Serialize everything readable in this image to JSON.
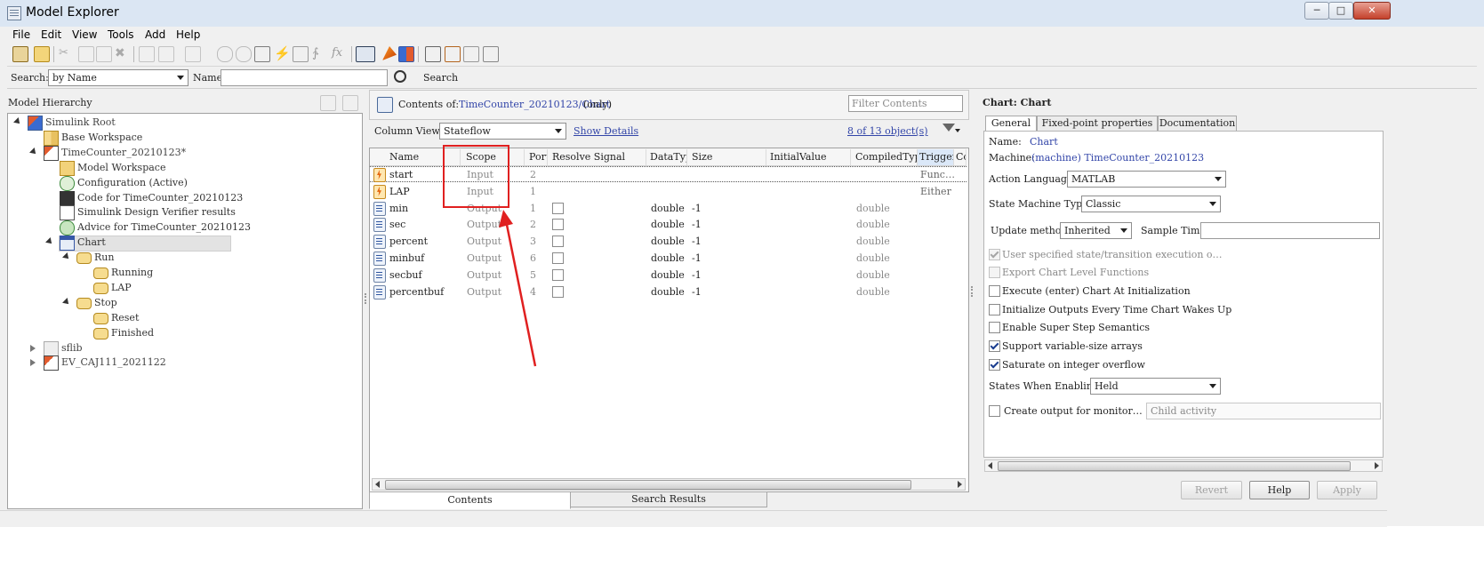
{
  "window": {
    "title": "Model Explorer",
    "buttons": {
      "minimize": "─",
      "maximize": "□",
      "close": "✕"
    }
  },
  "menu": [
    "File",
    "Edit",
    "View",
    "Tools",
    "Add",
    "Help"
  ],
  "search_bar": {
    "search_label": "Search:",
    "search_by": "by Name",
    "name_label": "Name:",
    "name_value": "",
    "search_button": "Search"
  },
  "hierarchy": {
    "title": "Model Hierarchy",
    "items": [
      {
        "label": "Simulink Root",
        "icon": "simulink-root-icon"
      },
      {
        "label": "Base Workspace",
        "icon": "workspace-icon"
      },
      {
        "label": "TimeCounter_20210123*",
        "icon": "model-icon"
      },
      {
        "label": "Model Workspace",
        "icon": "model-workspace-icon"
      },
      {
        "label": "Configuration (Active)",
        "icon": "config-icon"
      },
      {
        "label": "Code for TimeCounter_20210123",
        "icon": "code-icon"
      },
      {
        "label": "Simulink Design Verifier results",
        "icon": "sldv-icon"
      },
      {
        "label": "Advice for TimeCounter_20210123",
        "icon": "advice-icon"
      },
      {
        "label": "Chart",
        "icon": "chart-icon"
      },
      {
        "label": "Run",
        "icon": "state-icon"
      },
      {
        "label": "Running",
        "icon": "state-icon"
      },
      {
        "label": "LAP",
        "icon": "state-icon"
      },
      {
        "label": "Stop",
        "icon": "state-icon"
      },
      {
        "label": "Reset",
        "icon": "state-icon"
      },
      {
        "label": "Finished",
        "icon": "state-icon"
      },
      {
        "label": "sflib",
        "icon": "library-icon"
      },
      {
        "label": "EV_CAJ111_2021122",
        "icon": "model-icon"
      }
    ]
  },
  "contents": {
    "label": "Contents of:",
    "path": "TimeCounter_20210123/Chart",
    "scope_note": "(only)",
    "filter_placeholder": "Filter Contents",
    "column_view_label": "Column View:",
    "column_view": "Stateflow",
    "show_details": "Show Details",
    "object_count": "8 of 13 object(s)",
    "columns": [
      "Name",
      "Scope",
      "Port",
      "Resolve Signal",
      "DataType",
      "Size",
      "InitialValue",
      "CompiledType",
      "Trigger",
      "Co"
    ],
    "rows": [
      {
        "icon": "event-icon",
        "name": "start",
        "scope": "Input",
        "port": "2",
        "resolve": false,
        "datatype": "",
        "size": "",
        "compiled": "",
        "trigger": "Func…"
      },
      {
        "icon": "event-icon",
        "name": "LAP",
        "scope": "Input",
        "port": "1",
        "resolve": false,
        "datatype": "",
        "size": "",
        "compiled": "",
        "trigger": "Either"
      },
      {
        "icon": "data-icon",
        "name": "min",
        "scope": "Output",
        "port": "1",
        "resolve": false,
        "datatype": "double",
        "size": "-1",
        "compiled": "double",
        "trigger": ""
      },
      {
        "icon": "data-icon",
        "name": "sec",
        "scope": "Output",
        "port": "2",
        "resolve": false,
        "datatype": "double",
        "size": "-1",
        "compiled": "double",
        "trigger": ""
      },
      {
        "icon": "data-icon",
        "name": "percent",
        "scope": "Output",
        "port": "3",
        "resolve": false,
        "datatype": "double",
        "size": "-1",
        "compiled": "double",
        "trigger": ""
      },
      {
        "icon": "data-icon",
        "name": "minbuf",
        "scope": "Output",
        "port": "6",
        "resolve": false,
        "datatype": "double",
        "size": "-1",
        "compiled": "double",
        "trigger": ""
      },
      {
        "icon": "data-icon",
        "name": "secbuf",
        "scope": "Output",
        "port": "5",
        "resolve": false,
        "datatype": "double",
        "size": "-1",
        "compiled": "double",
        "trigger": ""
      },
      {
        "icon": "data-icon",
        "name": "percentbuf",
        "scope": "Output",
        "port": "4",
        "resolve": false,
        "datatype": "double",
        "size": "-1",
        "compiled": "double",
        "trigger": ""
      }
    ],
    "bottom_tabs": [
      "Contents",
      "Search Results"
    ]
  },
  "properties": {
    "title": "Chart: Chart",
    "tabs": [
      "General",
      "Fixed-point properties",
      "Documentation"
    ],
    "name_label": "Name:",
    "name_value": "Chart",
    "machine_label": "Machine:",
    "machine_value": "(machine) TimeCounter_20210123",
    "action_language_label": "Action Language:",
    "action_language": "MATLAB",
    "state_machine_type_label": "State Machine Type:",
    "state_machine_type": "Classic",
    "update_method_label": "Update method:",
    "update_method": "Inherited",
    "sample_time_label": "Sample Time:",
    "sample_time": "",
    "checkboxes": [
      {
        "label": "User specified state/transition execution o…",
        "checked": true,
        "disabled": true
      },
      {
        "label": "Export Chart Level Functions",
        "checked": false,
        "disabled": true
      },
      {
        "label": "Execute (enter) Chart At Initialization",
        "checked": false,
        "disabled": false
      },
      {
        "label": "Initialize Outputs Every Time Chart Wakes Up",
        "checked": false,
        "disabled": false
      },
      {
        "label": "Enable Super Step Semantics",
        "checked": false,
        "disabled": false
      },
      {
        "label": "Support variable-size arrays",
        "checked": true,
        "disabled": false
      },
      {
        "label": "Saturate on integer overflow",
        "checked": true,
        "disabled": false
      }
    ],
    "states_when_enabling_label": "States When Enabling:",
    "states_when_enabling": "Held",
    "create_output_label": "Create output for monitor…",
    "create_output_checked": false,
    "child_activity": "Child activity",
    "buttons": {
      "revert": "Revert",
      "help": "Help",
      "apply": "Apply"
    }
  },
  "colors": {
    "annotation_red": "#e02020",
    "link_blue": "#3245a8",
    "titlebar": "#dbe6f3"
  }
}
